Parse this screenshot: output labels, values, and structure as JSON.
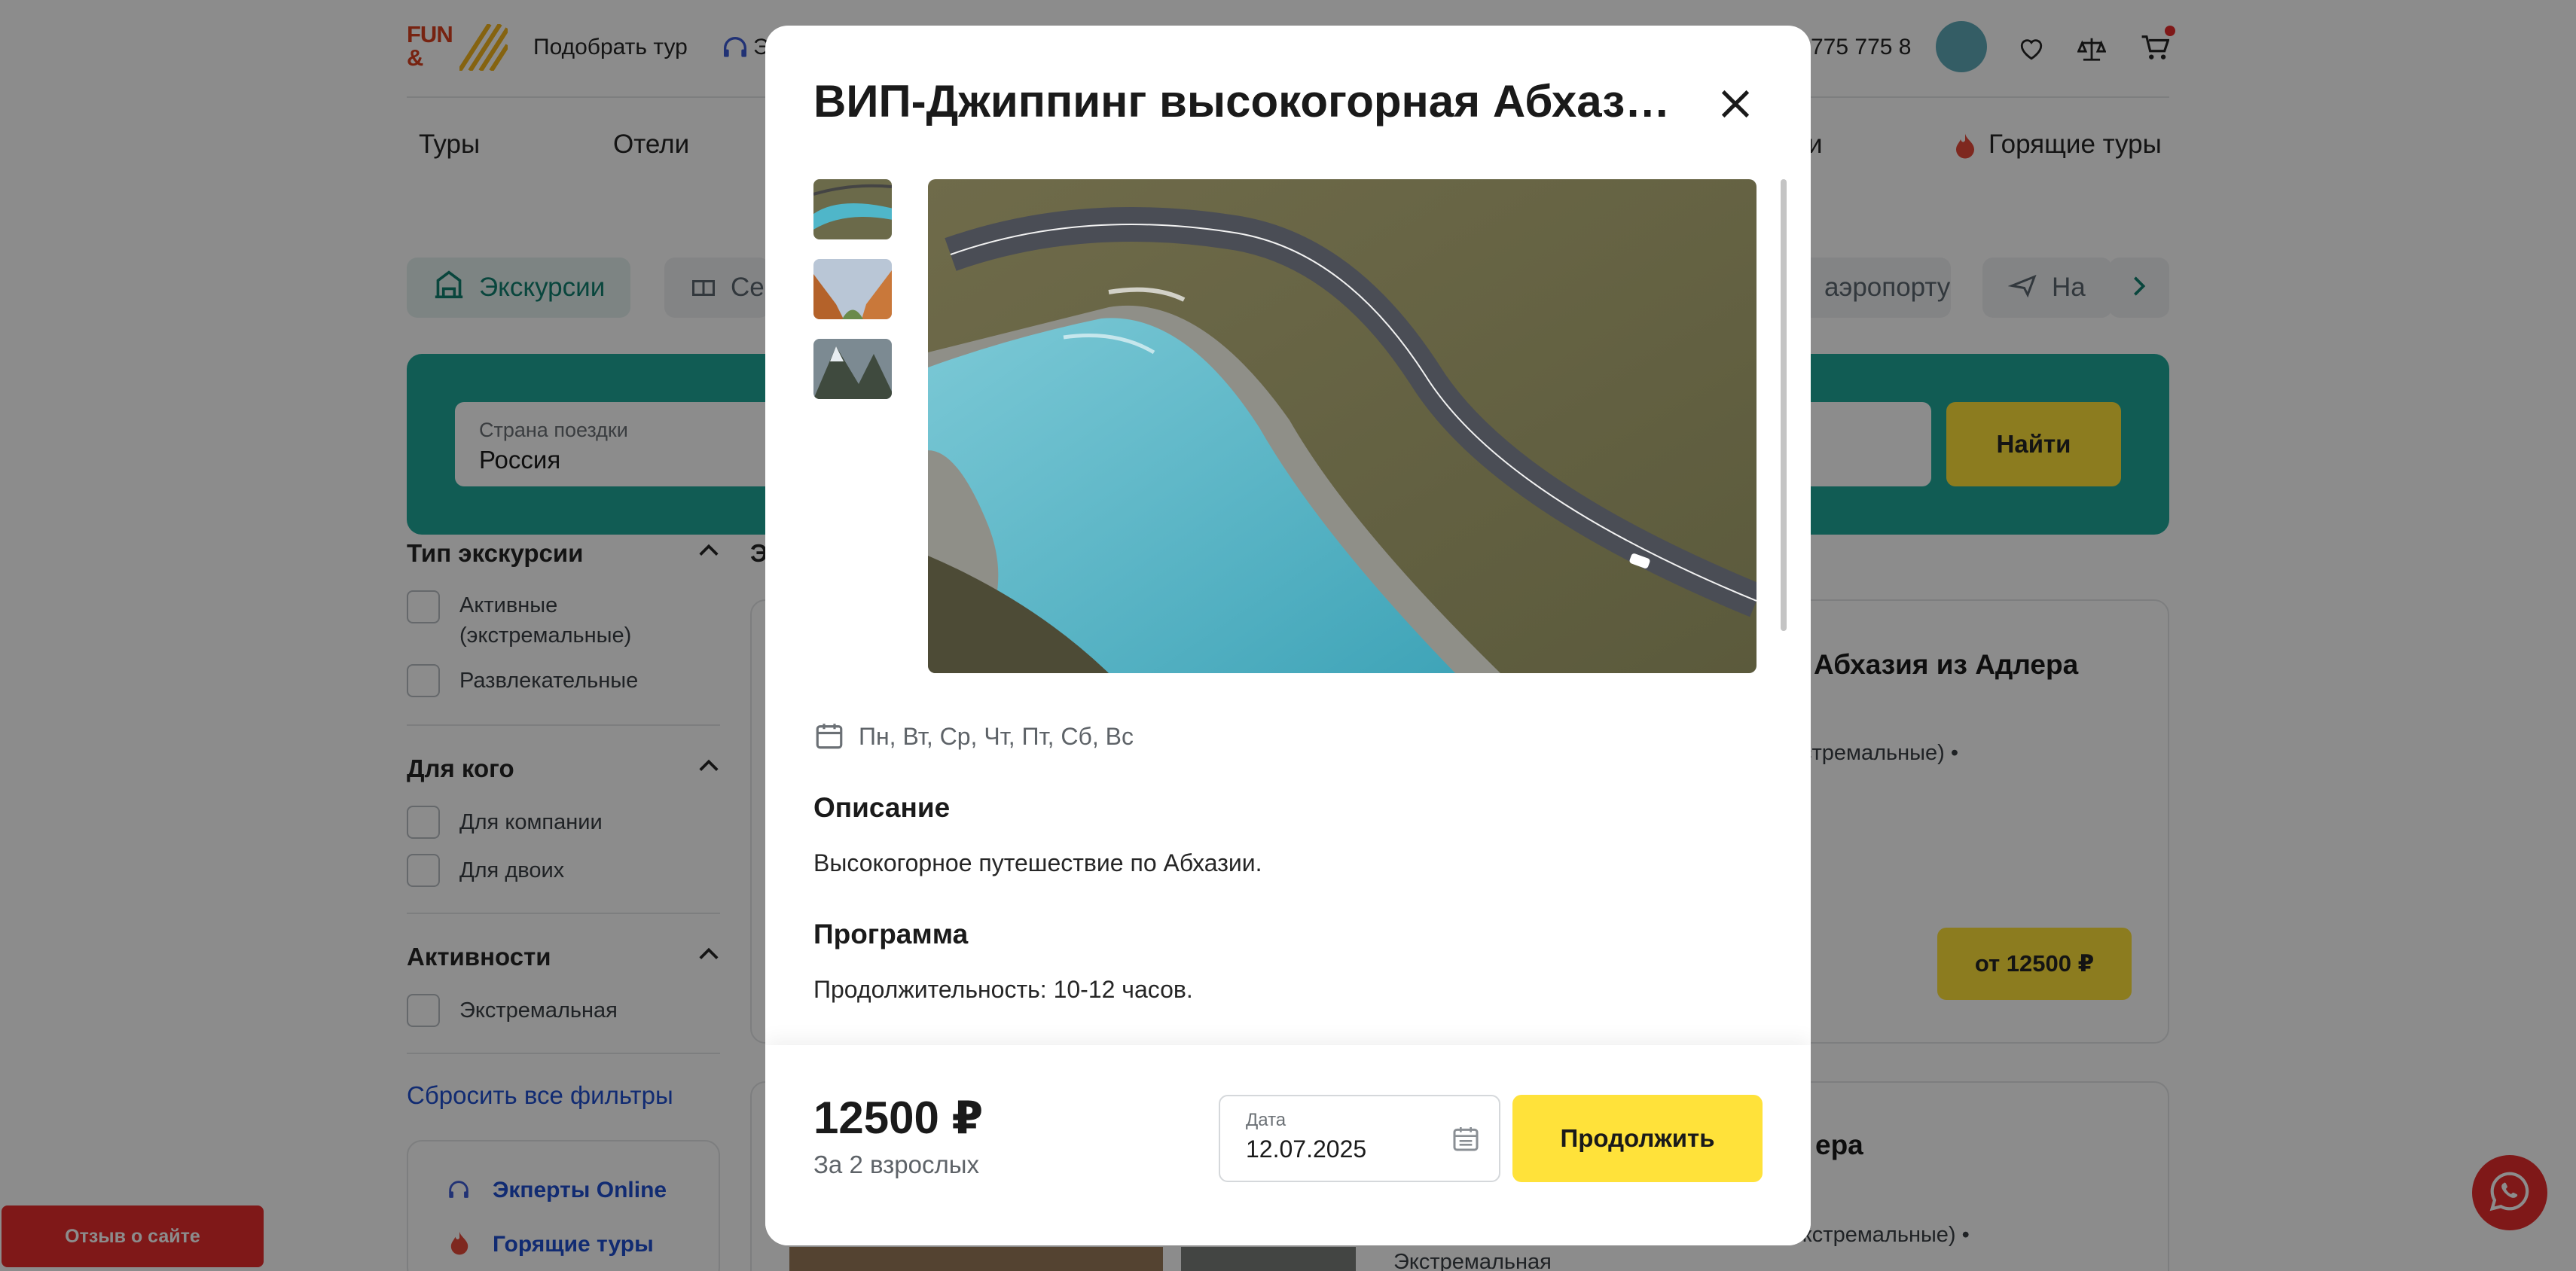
{
  "header": {
    "logo_text": "FUN&SUN",
    "pick_tour": "Подобрать тур",
    "experts_fragment": "Э",
    "phone": "775 775 8"
  },
  "main_tabs": [
    "Туры",
    "Отели",
    "и",
    "Горящие туры"
  ],
  "chips": [
    {
      "label": "Экскурсии",
      "active": true
    },
    {
      "label": "Се",
      "active": false
    },
    {
      "label": "аэропорту",
      "active": false
    },
    {
      "label": "На",
      "active": false
    }
  ],
  "search": {
    "country_label": "Страна поездки",
    "country_value": "Россия",
    "find_label": "Найти"
  },
  "filters": {
    "groups": [
      {
        "title": "Тип экскурсии",
        "options": [
          "Активные (экстремальные)",
          "Развлекательные"
        ]
      },
      {
        "title": "Для кого",
        "options": [
          "Для компании",
          "Для двоих"
        ]
      },
      {
        "title": "Активности",
        "options": [
          "Экстремальная"
        ]
      }
    ],
    "reset_label": "Сбросить все фильтры",
    "section_fragment": "Э"
  },
  "side_links": [
    "Экперты Online",
    "Горящие туры"
  ],
  "cards": [
    {
      "title_fragment": "Абхазия из Адлера",
      "type_fragment": "кстремальные) •",
      "price": "от 12500 ₽"
    },
    {
      "title_fragment": "ера",
      "type_fragment": "экстремальные) •",
      "activity_fragment": "Экстремальная"
    }
  ],
  "review_label": "Отзыв о сайте",
  "modal": {
    "title": "ВИП-Джиппинг высокогорная Абхазия из Адлера",
    "days": "Пн, Вт, Ср, Чт, Пт, Сб, Вс",
    "description_h": "Описание",
    "description_t": "Высокогорное путешествие по Абхазии.",
    "program_h": "Программа",
    "program_t": "Продолжительность: 10-12 часов.",
    "price": "12500 ₽",
    "price_sub": "За 2 взрослых",
    "date_label": "Дата",
    "date_value": "12.07.2025",
    "continue_label": "Продолжить"
  },
  "colors": {
    "accent_yellow": "#ffe23a",
    "teal": "#1fa89a",
    "red": "#e82d2d",
    "link_blue": "#1f4fd0"
  }
}
